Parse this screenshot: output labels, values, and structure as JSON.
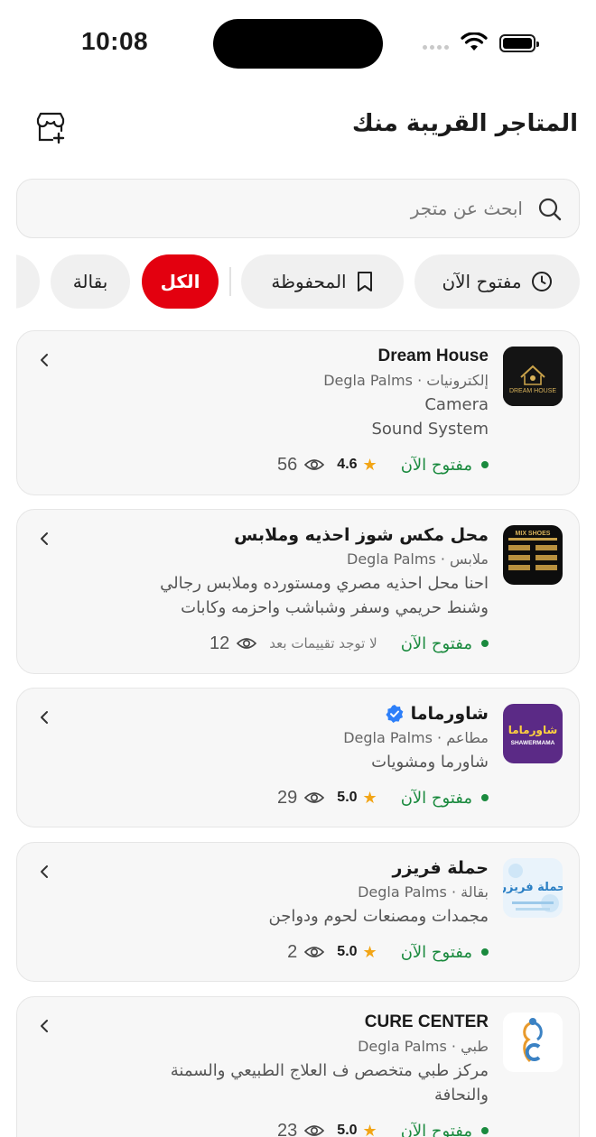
{
  "status_bar": {
    "time": "10:08"
  },
  "header": {
    "title": "المتاجر القريبة منك"
  },
  "search": {
    "placeholder": "ابحث عن متجر",
    "value": ""
  },
  "filters": [
    {
      "label": "مفتوح الآن",
      "icon": "clock-icon",
      "active": false
    },
    {
      "label": "المحفوظة",
      "icon": "bookmark-icon",
      "active": false
    },
    {
      "label": "الكل",
      "active": true
    },
    {
      "label": "بقالة",
      "active": false
    }
  ],
  "colors": {
    "accent": "#e3000f",
    "open_green": "#1a8a3e",
    "star": "#f2a516",
    "verified": "#2d7ff9"
  },
  "stores": [
    {
      "name": "Dream House",
      "meta": "إلكترونيات · Degla Palms",
      "desc": [
        "Camera",
        "Sound System"
      ],
      "status": "مفتوح الآن",
      "rating": "4.6",
      "views": "56",
      "logo": "DREAM HOUSE"
    },
    {
      "name": "محل مكس شوز احذيه وملابس",
      "meta": "ملابس · Degla Palms",
      "desc": [
        "احنا محل احذيه مصري ومستورده وملابس رجالي",
        "وشنط حريمي وسفر وشباشب واحزمه وكابات"
      ],
      "status": "مفتوح الآن",
      "no_reviews": "لا توجد تقييمات بعد",
      "views": "12",
      "logo": "MIX SHOES"
    },
    {
      "name": "شاورماما",
      "verified": true,
      "meta": "مطاعم · Degla Palms",
      "desc": [
        "شاورما ومشويات"
      ],
      "status": "مفتوح الآن",
      "rating": "5.0",
      "views": "29",
      "logo_ar": "شاورماما",
      "logo": "SHAWERMAMA"
    },
    {
      "name": "حملة فريزر",
      "meta": "بقالة · Degla Palms",
      "desc": [
        "مجمدات ومصنعات لحوم ودواجن"
      ],
      "status": "مفتوح الآن",
      "rating": "5.0",
      "views": "2",
      "logo_ar": "حملة فريزر"
    },
    {
      "name": "CURE CENTER",
      "meta": "طبي · Degla Palms",
      "desc": [
        "مركز طبي متخصص ف العلاج الطبيعي والسمنة",
        "والنحافة"
      ],
      "status": "مفتوح الآن",
      "rating": "5.0",
      "views": "23"
    }
  ]
}
